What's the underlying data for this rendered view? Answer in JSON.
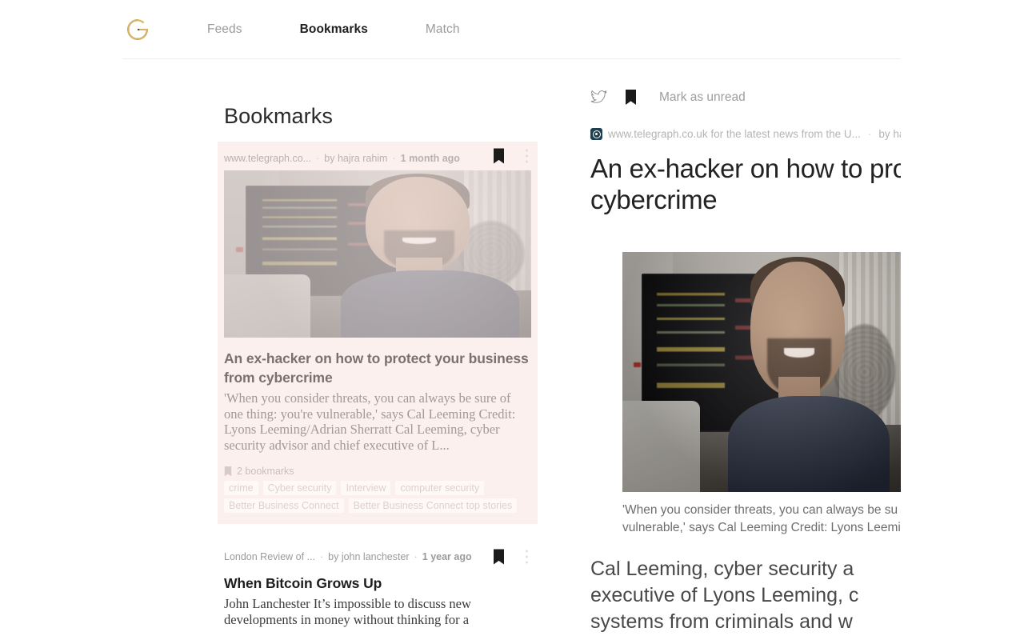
{
  "header": {
    "logo": "g-logo",
    "nav": [
      {
        "label": "Feeds",
        "active": false
      },
      {
        "label": "Bookmarks",
        "active": true
      },
      {
        "label": "Match",
        "active": false
      }
    ]
  },
  "left": {
    "title": "Bookmarks",
    "cards": [
      {
        "source": "www.telegraph.co...",
        "author": "by hajra rahim",
        "time": "1 month ago",
        "separator": "·",
        "bookmark_icon": "bookmark-filled-icon",
        "menu_icon": "kebab-menu-icon",
        "thumbnail": "article-photo-man-at-computer",
        "title": "An ex-hacker on how to protect your business from cybercrime",
        "snippet": "'When you consider threats, you can always be sure of one thing: you're vulnerable,' says Cal Leeming Credit: Lyons Leeming/Adrian Sherratt Cal Leeming, cyber security advisor and chief executive of L...",
        "bookmark_count": "2 bookmarks",
        "tags": [
          "crime",
          "Cyber security",
          "Interview",
          "computer security",
          "Better Business Connect",
          "Better Business Connect top stories"
        ]
      },
      {
        "source": "London Review of ...",
        "author": "by john lanchester",
        "time": "1 year ago",
        "separator": "·",
        "bookmark_icon": "bookmark-filled-icon",
        "menu_icon": "kebab-menu-icon",
        "title": "When Bitcoin Grows Up",
        "snippet": "John Lanchester It’s impossible to discuss new developments in money without thinking for a"
      }
    ]
  },
  "reader": {
    "toolbar": {
      "twitter_icon": "twitter-bird-icon",
      "bookmark_icon": "bookmark-filled-icon",
      "mark_unread_label": "Mark as unread"
    },
    "favicon": "telegraph-favicon",
    "source": "www.telegraph.co.uk for the latest news from the U...",
    "separator": "·",
    "author": "by ha",
    "headline_line1": "An ex-hacker on how to protect",
    "headline_line2": "cybercrime",
    "figure": "article-photo-man-at-computer",
    "caption_line1": "'When you consider threats, you can always be su",
    "caption_line2": "vulnerable,' says Cal Leeming Credit: Lyons Leemi",
    "body_line1": "Cal Leeming, cyber security a",
    "body_line2": "executive of Lyons Leeming, c",
    "body_line3": "systems from criminals and w"
  },
  "colors": {
    "card_tint": "#fcf0ef",
    "accent_gold": "#d8b45e",
    "logo_dark": "#4a4a4a",
    "nav_active": "#1f1f1f",
    "nav_inactive": "#9b9b9b"
  }
}
